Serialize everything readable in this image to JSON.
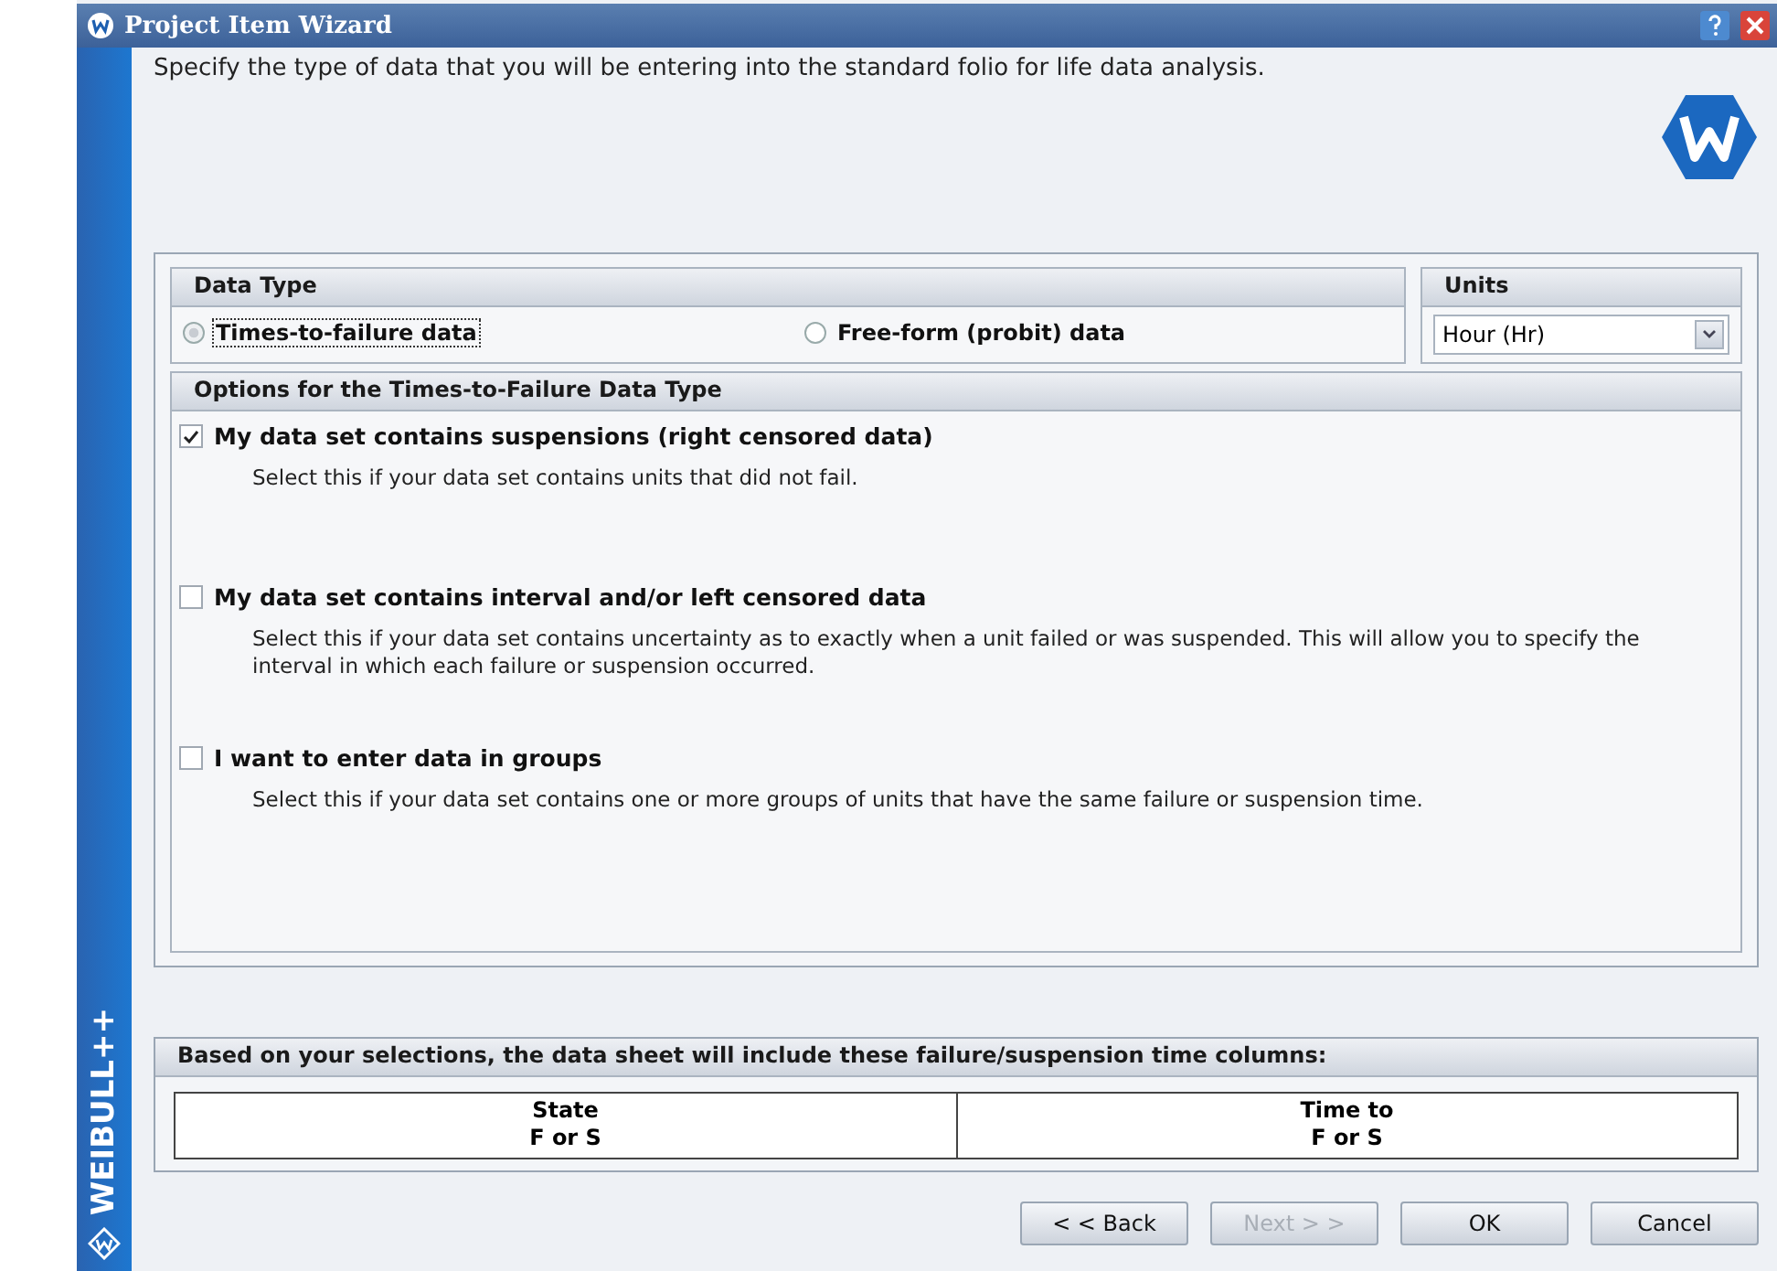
{
  "window": {
    "title": "Project Item Wizard"
  },
  "brand": "WEIBULL++",
  "description": "Specify the type of data that you will be entering into the standard folio for life data analysis.",
  "data_type": {
    "header": "Data Type",
    "options": [
      {
        "label": "Times-to-failure data",
        "selected": true
      },
      {
        "label": "Free-form (probit) data",
        "selected": false
      }
    ]
  },
  "units": {
    "header": "Units",
    "value": "Hour (Hr)"
  },
  "options_section": {
    "header": "Options for the Times-to-Failure Data Type",
    "items": [
      {
        "label": "My data set contains suspensions (right censored data)",
        "checked": true,
        "description": "Select this if your data set contains units that did not fail."
      },
      {
        "label": "My data set contains interval and/or left censored data",
        "checked": false,
        "description": "Select this if your data set contains uncertainty as to exactly when a unit failed or was suspended. This will allow you to specify the interval in which each failure or suspension occurred."
      },
      {
        "label": "I want to enter data in groups",
        "checked": false,
        "description": "Select this if your data set contains one or more groups of units that have the same failure or suspension time."
      }
    ]
  },
  "columns_section": {
    "header": "Based on your selections, the data sheet will include these failure/suspension time columns:",
    "columns": [
      {
        "lines": [
          "State",
          "F or S"
        ]
      },
      {
        "lines": [
          "Time to",
          "F or S"
        ]
      }
    ]
  },
  "buttons": [
    {
      "label": "< < Back",
      "disabled": false
    },
    {
      "label": "Next > >",
      "disabled": true
    },
    {
      "label": "OK",
      "disabled": false
    },
    {
      "label": "Cancel",
      "disabled": false
    }
  ]
}
